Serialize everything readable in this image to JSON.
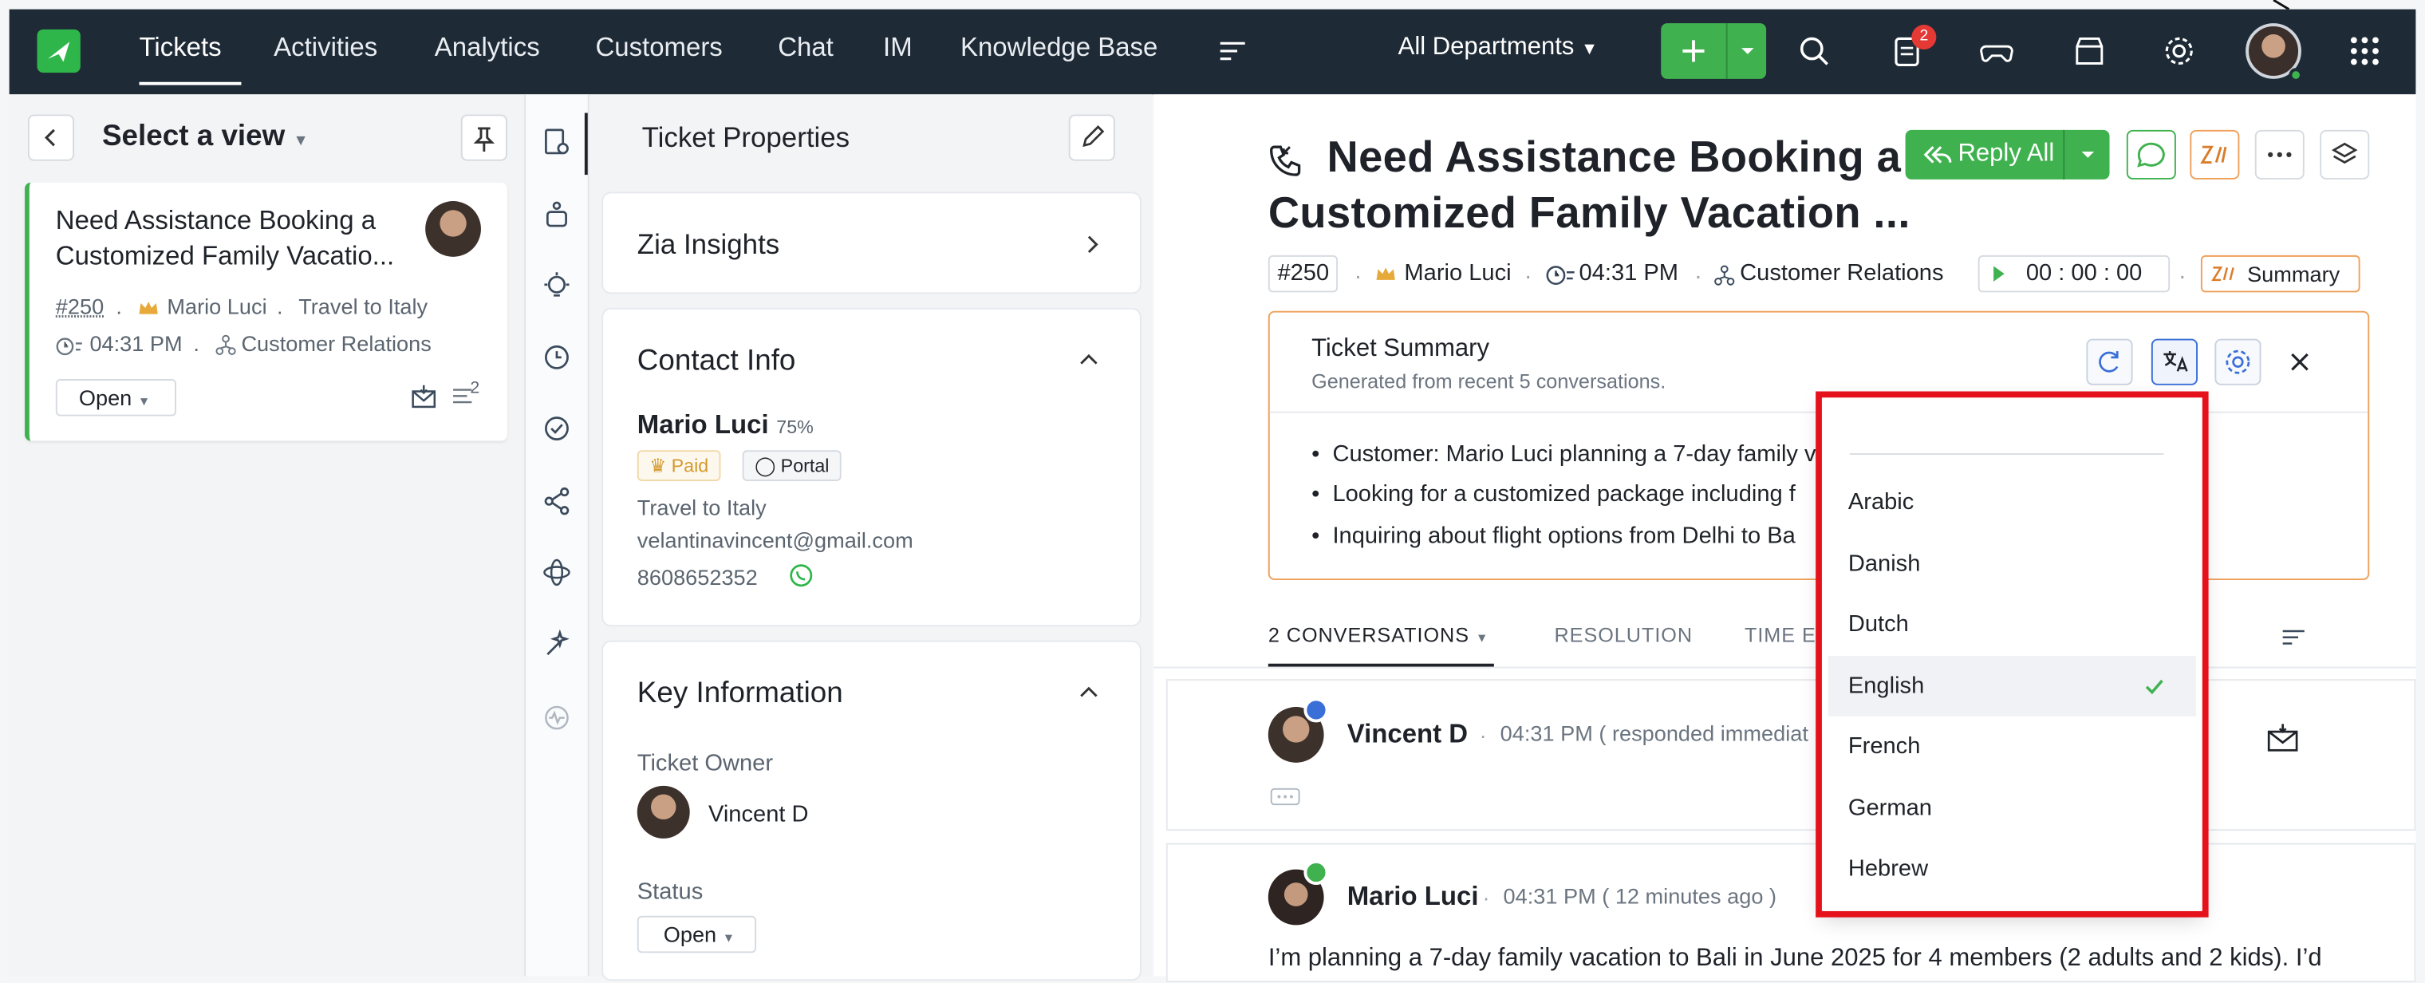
{
  "topbar": {
    "nav": [
      "Tickets",
      "Activities",
      "Analytics",
      "Customers",
      "Chat",
      "IM",
      "Knowledge Base"
    ],
    "department": "All Departments",
    "notification_count": "2",
    "icons": [
      "menu-icon",
      "search-icon",
      "notes-icon",
      "gamepad-icon",
      "store-icon",
      "gear-icon",
      "apps-grid-icon"
    ]
  },
  "left": {
    "view_label": "Select a view",
    "ticket": {
      "title_line1": "Need Assistance Booking a",
      "title_line2": "Customized Family Vacatio...",
      "number": "#250",
      "contact": "Mario Luci",
      "account": "Travel to Italy",
      "time": "04:31 PM",
      "team": "Customer Relations",
      "status": "Open",
      "thread_count": "2"
    }
  },
  "props": {
    "title": "Ticket Properties",
    "zia": "Zia Insights",
    "contact_head": "Contact Info",
    "contact_name": "Mario Luci",
    "contact_score": "75%",
    "tag_paid": "Paid",
    "tag_portal": "Portal",
    "account": "Travel to Italy",
    "email": "velantinavincent@gmail.com",
    "phone": "8608652352",
    "key_head": "Key Information",
    "owner_label": "Ticket Owner",
    "owner": "Vincent D",
    "status_label": "Status",
    "status": "Open"
  },
  "main": {
    "title_line1": "Need Assistance Booking a",
    "title_line2": "Customized Family Vacation ...",
    "reply_label": "Reply All",
    "ticket_no": "#250",
    "contact": "Mario Luci",
    "time": "04:31 PM",
    "team": "Customer Relations",
    "timer": "00 : 00 : 00",
    "summary_btn": "Summary",
    "summary": {
      "title": "Ticket Summary",
      "subtitle": "Generated from recent 5 conversations.",
      "bullets": [
        "Customer: Mario Luci planning a 7-day family v",
        "Looking for a customized package including f",
        "Inquiring about flight options from Delhi to Ba"
      ]
    },
    "tabs": [
      "2 CONVERSATIONS",
      "RESOLUTION",
      "TIME E"
    ],
    "conversations": [
      {
        "name": "Vincent D",
        "time": "04:31 PM ( responded immediat"
      },
      {
        "name": "Mario Luci",
        "time": "04:31 PM ( 12 minutes ago )",
        "body": "I’m planning a 7-day family vacation to Bali in June 2025 for 4 members (2 adults and 2 kids). I’d"
      }
    ]
  },
  "language_menu": {
    "options": [
      "Arabic",
      "Danish",
      "Dutch",
      "English",
      "French",
      "German",
      "Hebrew"
    ],
    "selected": "English"
  },
  "colors": {
    "nav_bg": "#1e2a36",
    "accent_green": "#3fb24f",
    "highlight_red": "#e6121b",
    "summary_border": "#f0a05a"
  }
}
